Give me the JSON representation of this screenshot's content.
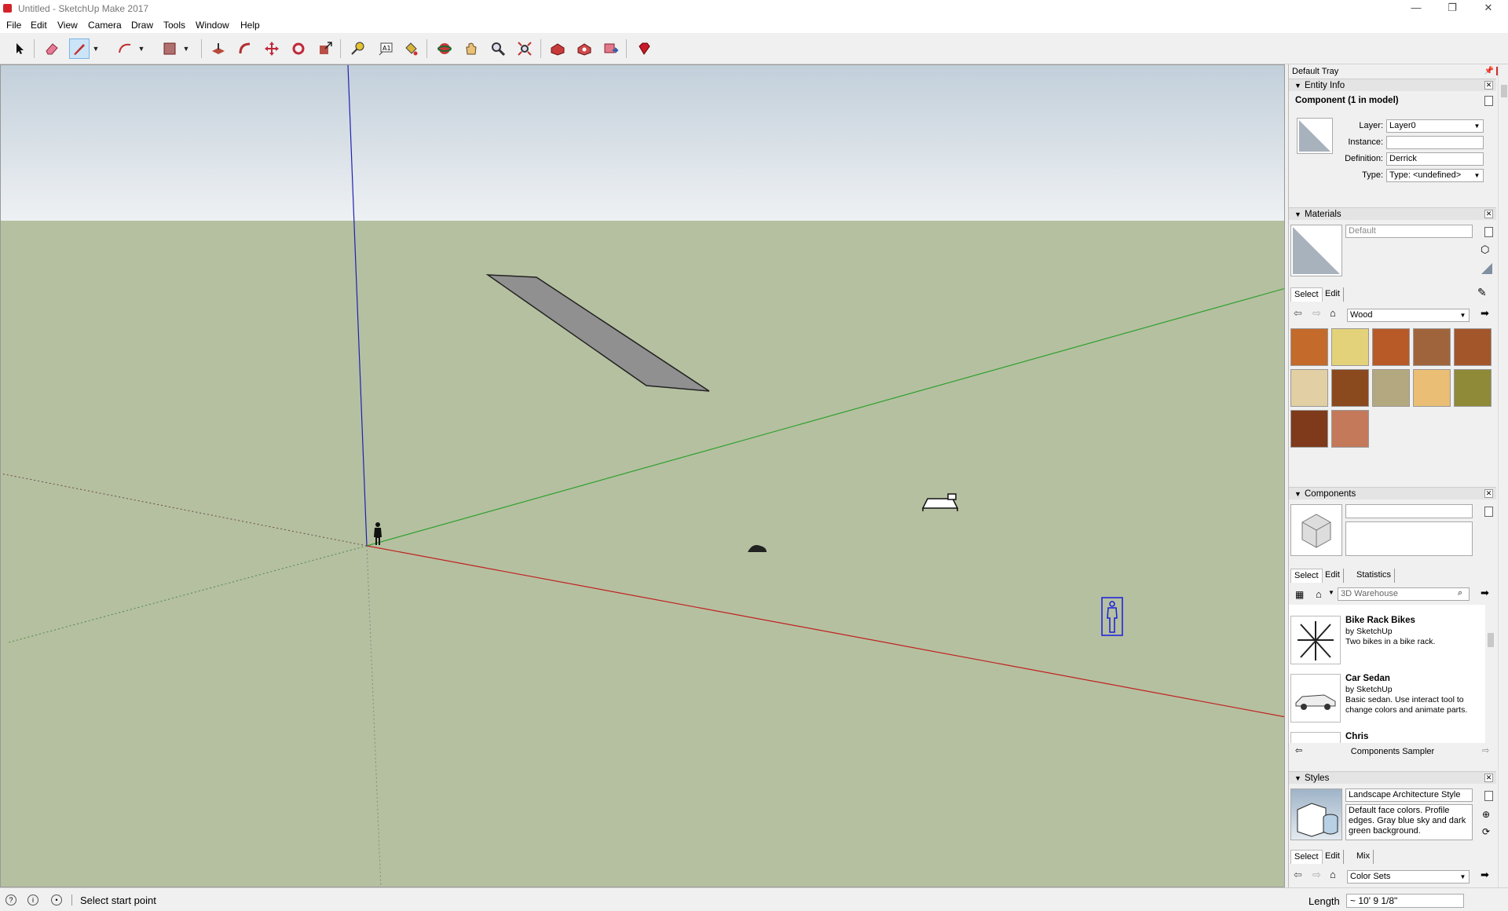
{
  "window": {
    "title": "Untitled - SketchUp Make 2017",
    "minimize": "—",
    "restore": "❐",
    "close": "✕"
  },
  "menu": [
    "File",
    "Edit",
    "View",
    "Camera",
    "Draw",
    "Tools",
    "Window",
    "Help"
  ],
  "toolbar": {
    "tools": [
      "select-tool",
      "eraser-tool",
      "line-tool",
      "arc-tool",
      "rectangle-tool",
      "push-pull-tool",
      "offset-tool",
      "move-tool",
      "rotate-tool",
      "scale-tool",
      "tape-measure-tool",
      "text-tool",
      "paint-bucket-tool",
      "orbit-tool",
      "pan-tool",
      "zoom-tool",
      "zoom-extents-tool",
      "warehouse-tool",
      "extension-warehouse-tool",
      "send-to-layout-tool",
      "ruby-tool"
    ],
    "active": "line-tool"
  },
  "colors": {
    "sky_top": "#c2cfda",
    "sky_bottom": "#eef1f3",
    "ground": "#b5c0a0",
    "red_axis": "#c02020",
    "green_axis": "#2ea02e",
    "blue_axis": "#2020b0",
    "selection": "#1a1ae0"
  },
  "tray": {
    "title": "Default Tray",
    "entity_info": {
      "heading": "Entity Info",
      "entity": "Component (1 in model)",
      "layer_label": "Layer:",
      "layer_value": "Layer0",
      "instance_label": "Instance:",
      "instance_value": "",
      "definition_label": "Definition:",
      "definition_value": "Derrick",
      "type_label": "Type:",
      "type_value": "Type: <undefined>"
    },
    "materials": {
      "heading": "Materials",
      "current": "Default",
      "tabs": [
        "Select",
        "Edit"
      ],
      "collection": "Wood",
      "swatches": [
        "#c46a2a",
        "#e4d27a",
        "#b85a28",
        "#a0643c",
        "#a3562a",
        "#e2cfa3",
        "#8a4a1e",
        "#b4a880",
        "#eabe74",
        "#8e8a38",
        "#7e3a1a",
        "#c47a5a"
      ]
    },
    "components": {
      "heading": "Components",
      "tabs": [
        "Select",
        "Edit",
        "Statistics"
      ],
      "search_placeholder": "3D Warehouse",
      "items": [
        {
          "name": "Bike Rack Bikes",
          "by": "by SketchUp",
          "desc": "Two bikes in a bike rack."
        },
        {
          "name": "Car Sedan",
          "by": "by SketchUp",
          "desc": "Basic sedan.  Use interact tool to change colors and animate parts."
        },
        {
          "name": "Chris",
          "by": "",
          "desc": ""
        }
      ],
      "collection": "Components Sampler"
    },
    "styles": {
      "heading": "Styles",
      "name": "Landscape Architecture Style",
      "desc": "Default face colors. Profile edges. Gray blue sky and dark green background.",
      "tabs": [
        "Select",
        "Edit",
        "Mix"
      ],
      "collection": "Color Sets"
    }
  },
  "status": {
    "message": "Select start point",
    "measure_label": "Length",
    "measure_value": "~ 10' 9 1/8\""
  }
}
